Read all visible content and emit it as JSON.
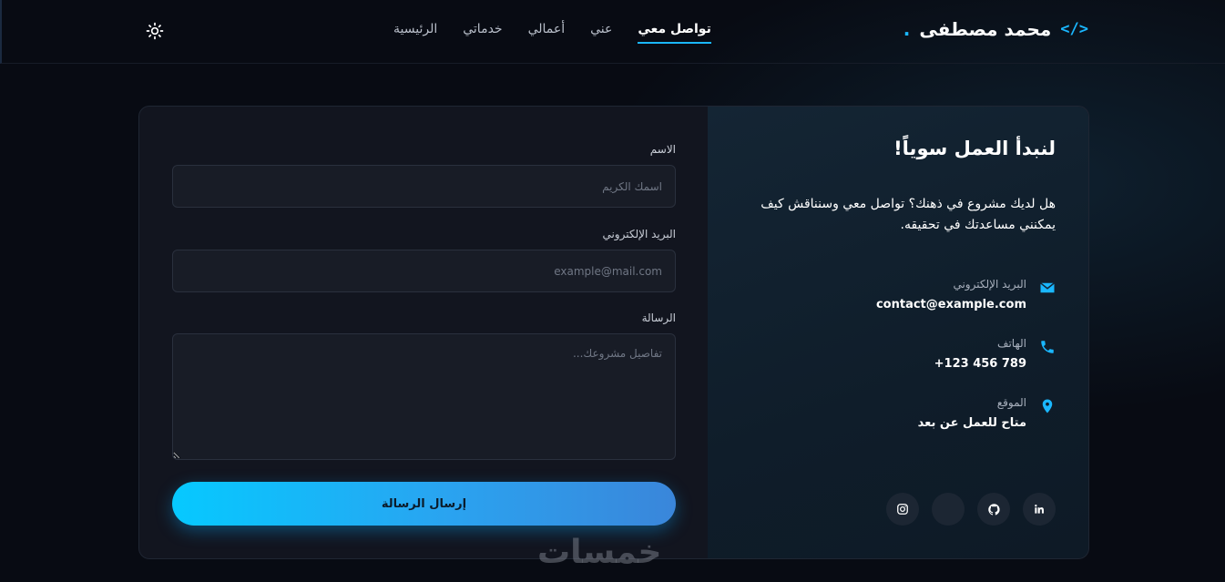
{
  "header": {
    "logo_mark": "</>",
    "logo_name": "محمد مصطفى",
    "logo_dot": ".",
    "nav": [
      {
        "label": "الرئيسية",
        "active": false
      },
      {
        "label": "خدماتي",
        "active": false
      },
      {
        "label": "أعمالي",
        "active": false
      },
      {
        "label": "عني",
        "active": false
      },
      {
        "label": "تواصل معي",
        "active": true
      }
    ],
    "theme_icon": "gear-icon"
  },
  "info": {
    "title": "لنبدأ العمل سوياً!",
    "description": "هل لديك مشروع في ذهنك؟ تواصل معي وسنناقش كيف يمكنني مساعدتك في تحقيقه.",
    "items": [
      {
        "icon": "envelope-icon",
        "label": "البريد الإلكتروني",
        "value": "contact@example.com"
      },
      {
        "icon": "phone-icon",
        "label": "الهاتف",
        "value": "+123 456 789"
      },
      {
        "icon": "location-pin-icon",
        "label": "الموقع",
        "value": "متاح للعمل عن بعد"
      }
    ],
    "socials": [
      "linkedin-icon",
      "github-icon",
      "blank-social-icon",
      "instagram-icon"
    ]
  },
  "form": {
    "name_label": "الاسم",
    "name_placeholder": "اسمك الكريم",
    "email_label": "البريد الإلكتروني",
    "email_placeholder": "example@mail.com",
    "message_label": "الرسالة",
    "message_placeholder": "تفاصيل مشروعك...",
    "submit_label": "إرسال الرسالة"
  },
  "watermark": "خمسات",
  "colors": {
    "accent": "#1ab7ff",
    "background": "#080b13",
    "card": "#12151f",
    "info_panel": "#142534"
  }
}
